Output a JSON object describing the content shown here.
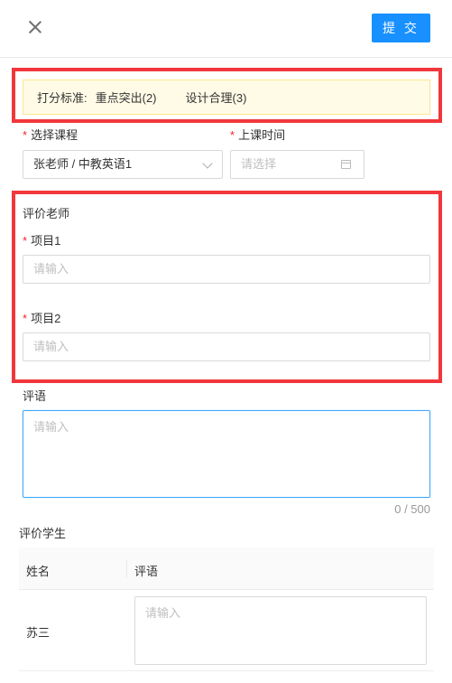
{
  "header": {
    "submit_label": "提 交"
  },
  "criteria": {
    "prefix": "打分标准:",
    "items": [
      "重点突出(2)",
      "设计合理(3)"
    ]
  },
  "course": {
    "label": "选择课程",
    "value": "张老师 / 中教英语1"
  },
  "time": {
    "label": "上课时间",
    "placeholder": "请选择"
  },
  "teacher_eval": {
    "title": "评价老师",
    "items": [
      {
        "label": "项目1",
        "placeholder": "请输入"
      },
      {
        "label": "项目2",
        "placeholder": "请输入"
      }
    ]
  },
  "comment": {
    "label": "评语",
    "placeholder": "请输入",
    "counter": "0 / 500"
  },
  "student_eval": {
    "title": "评价学生",
    "columns": [
      "姓名",
      "评语"
    ],
    "rows": [
      {
        "name": "苏三",
        "placeholder": "请输入"
      }
    ]
  },
  "colors": {
    "primary": "#1890ff",
    "highlight_frame": "#f1373b",
    "required": "#f5222d",
    "banner_bg": "#fffbe6"
  }
}
